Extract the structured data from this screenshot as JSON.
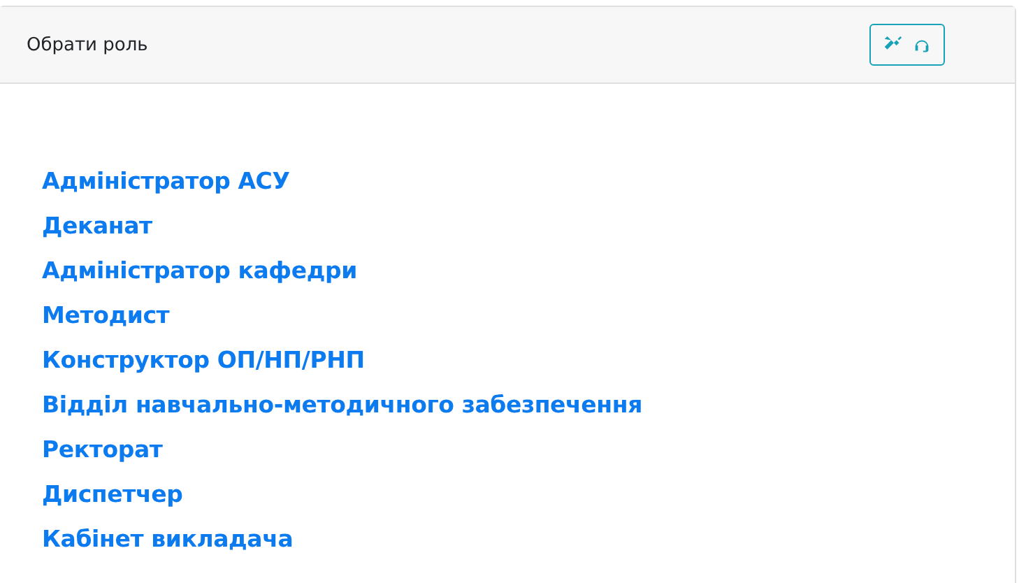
{
  "card": {
    "title": "Обрати роль"
  },
  "roles": [
    "Адміністратор АСУ",
    "Деканат",
    "Адміністратор кафедри",
    "Методист",
    "Конструктор ОП/НП/РНП",
    "Відділ навчально-методичного забезпечення",
    "Ректорат",
    "Диспетчер",
    "Кабінет викладача"
  ]
}
